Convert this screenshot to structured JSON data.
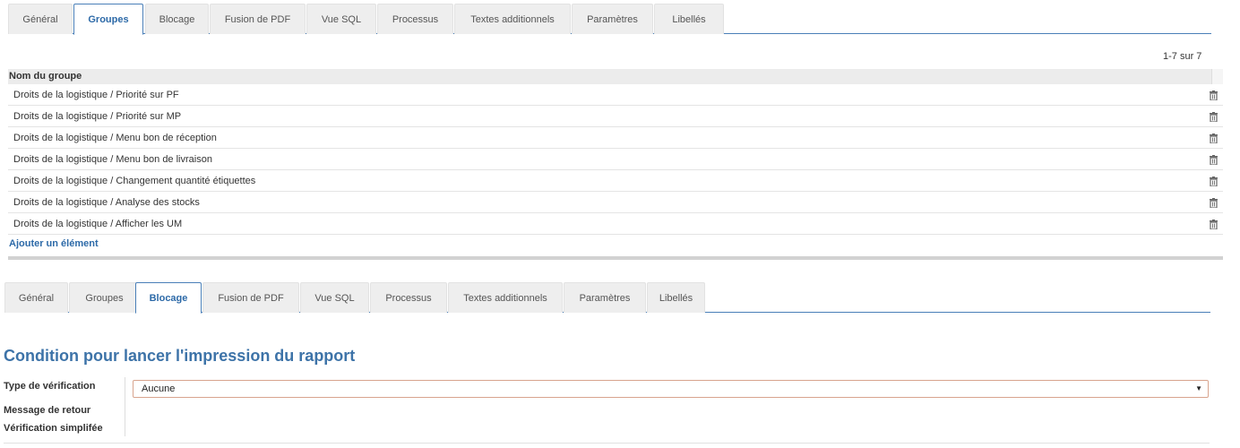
{
  "top_tabs": [
    {
      "label": "Général",
      "active": false
    },
    {
      "label": "Groupes",
      "active": true
    },
    {
      "label": "Blocage",
      "active": false
    },
    {
      "label": "Fusion de PDF",
      "active": false
    },
    {
      "label": "Vue SQL",
      "active": false
    },
    {
      "label": "Processus",
      "active": false
    },
    {
      "label": "Textes additionnels",
      "active": false
    },
    {
      "label": "Paramètres",
      "active": false
    },
    {
      "label": "Libellés",
      "active": false
    }
  ],
  "groups": {
    "pager": "1-7 sur 7",
    "column_header": "Nom du groupe",
    "rows": [
      "Droits de la logistique / Priorité sur PF",
      "Droits de la logistique / Priorité sur MP",
      "Droits de la logistique / Menu bon de réception",
      "Droits de la logistique / Menu bon de livraison",
      "Droits de la logistique / Changement quantité étiquettes",
      "Droits de la logistique / Analyse des stocks",
      "Droits de la logistique / Afficher les UM"
    ],
    "row_action_icon": "trash-icon",
    "add_label": "Ajouter un élément"
  },
  "bottom_tabs": [
    {
      "label": "Général",
      "active": false
    },
    {
      "label": "Groupes",
      "active": false
    },
    {
      "label": "Blocage",
      "active": true
    },
    {
      "label": "Fusion de PDF",
      "active": false
    },
    {
      "label": "Vue SQL",
      "active": false
    },
    {
      "label": "Processus",
      "active": false
    },
    {
      "label": "Textes additionnels",
      "active": false
    },
    {
      "label": "Paramètres",
      "active": false
    },
    {
      "label": "Libellés",
      "active": false
    }
  ],
  "blocage": {
    "title": "Condition pour lancer l'impression du rapport",
    "verification_type_label": "Type de vérification",
    "verification_type_value": "Aucune",
    "return_message_label": "Message de retour",
    "simplified_verification_label": "Vérification simplifée"
  },
  "colors": {
    "accent": "#2d6aa8",
    "tab_background": "#eeeeee",
    "select_border": "#d8a48e"
  }
}
